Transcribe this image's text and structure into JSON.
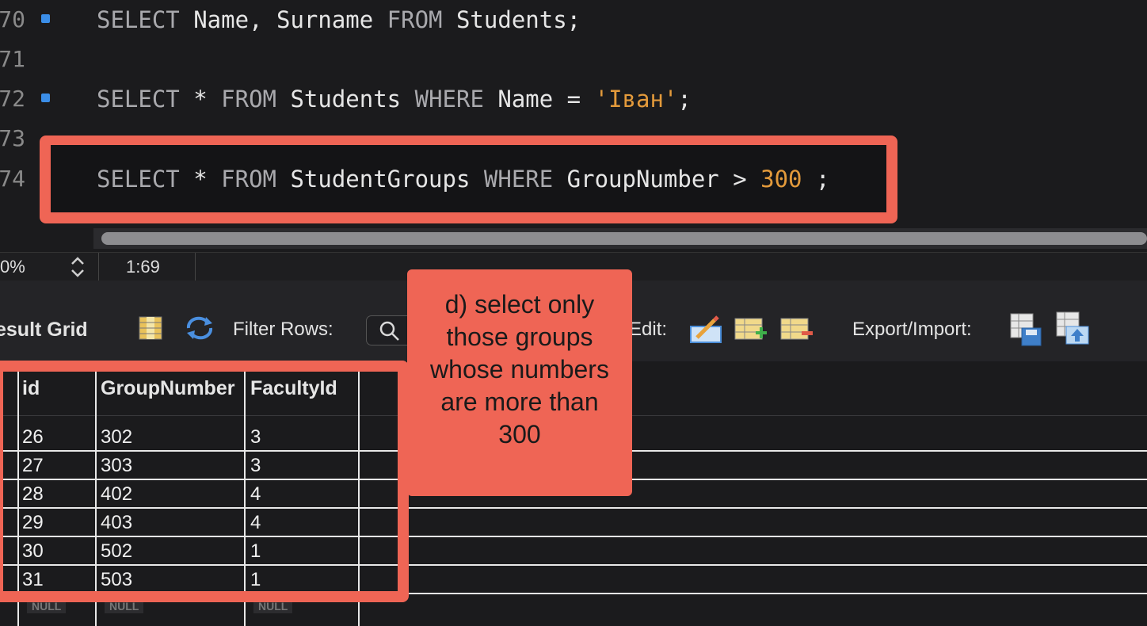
{
  "editor": {
    "lines": [
      {
        "number": "70",
        "breakpoint": true,
        "tokens": [
          {
            "t": "SELECT",
            "c": "kw"
          },
          {
            "t": " Name, Surname ",
            "c": ""
          },
          {
            "t": "FROM",
            "c": "kw"
          },
          {
            "t": " Students;",
            "c": ""
          }
        ]
      },
      {
        "number": "71",
        "breakpoint": false,
        "tokens": []
      },
      {
        "number": "72",
        "breakpoint": true,
        "tokens": [
          {
            "t": "SELECT",
            "c": "kw"
          },
          {
            "t": " * ",
            "c": ""
          },
          {
            "t": "FROM",
            "c": "kw"
          },
          {
            "t": " Students ",
            "c": ""
          },
          {
            "t": "WHERE",
            "c": "kw"
          },
          {
            "t": " Name = ",
            "c": ""
          },
          {
            "t": "'Іван'",
            "c": "str"
          },
          {
            "t": ";",
            "c": ""
          }
        ]
      },
      {
        "number": "73",
        "breakpoint": false,
        "tokens": []
      },
      {
        "number": "74",
        "breakpoint": false,
        "tokens": [
          {
            "t": "SELECT",
            "c": "kw"
          },
          {
            "t": " * ",
            "c": ""
          },
          {
            "t": "FROM",
            "c": "kw"
          },
          {
            "t": " StudentGroups ",
            "c": ""
          },
          {
            "t": "WHERE",
            "c": "kw"
          },
          {
            "t": " GroupNumber > ",
            "c": ""
          },
          {
            "t": "300",
            "c": "num"
          },
          {
            "t": " ;",
            "c": ""
          }
        ]
      }
    ]
  },
  "status": {
    "zoom": "0%",
    "cursor": "1:69"
  },
  "toolbar": {
    "title": "esult Grid",
    "filter_label": "Filter Rows:",
    "edit_label": "Edit:",
    "export_label": "Export/Import:"
  },
  "grid": {
    "columns": [
      "id",
      "GroupNumber",
      "FacultyId"
    ],
    "rows": [
      [
        "26",
        "302",
        "3"
      ],
      [
        "27",
        "303",
        "3"
      ],
      [
        "28",
        "402",
        "4"
      ],
      [
        "29",
        "403",
        "4"
      ],
      [
        "30",
        "502",
        "1"
      ],
      [
        "31",
        "503",
        "1"
      ]
    ],
    "null_label": "NULL"
  },
  "callout": {
    "text": "d) select only those groups whose numbers are more than 300"
  },
  "colors": {
    "accent": "#ef6555",
    "keyword": "#a9a9ad",
    "literal": "#e39a3b",
    "breakpoint": "#3b8ee8"
  }
}
